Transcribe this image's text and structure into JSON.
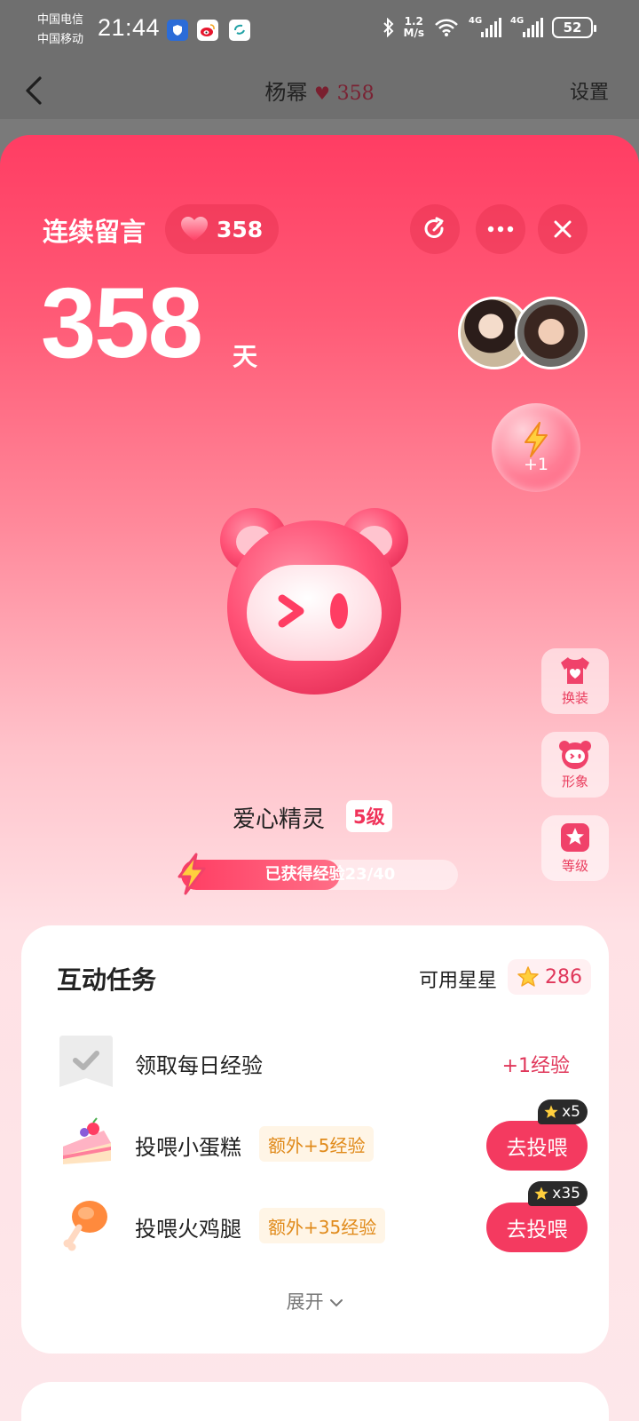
{
  "status_bar": {
    "carrier_1": "中国电信",
    "carrier_2": "中国移动",
    "time": "21:44",
    "net_speed_value": "1.2",
    "net_speed_unit": "M/s",
    "signal_1_tag": "4G",
    "signal_2_tag": "4G",
    "battery": "52"
  },
  "nav": {
    "title": "杨幂",
    "count": "358",
    "settings": "设置"
  },
  "header": {
    "streak_label": "连续留言",
    "heart_count": "358",
    "days": "358",
    "days_unit": "天"
  },
  "energy": {
    "plus_label": "+1"
  },
  "side_buttons": [
    {
      "label": "换装"
    },
    {
      "label": "形象"
    },
    {
      "label": "等级"
    }
  ],
  "pet": {
    "name": "爱心精灵",
    "level": "5级",
    "xp_text": "已获得经验23/40",
    "xp_current": 23,
    "xp_total": 40
  },
  "tasks": {
    "title": "互动任务",
    "stars_label": "可用星星",
    "stars_value": "286",
    "items": [
      {
        "name": "领取每日经验",
        "reward": "+1经验"
      },
      {
        "name": "投喂小蛋糕",
        "bonus": "额外+5经验",
        "button": "去投喂",
        "cost": "x5"
      },
      {
        "name": "投喂火鸡腿",
        "bonus": "额外+35经验",
        "button": "去投喂",
        "cost": "x35"
      }
    ],
    "expand": "展开"
  },
  "colors": {
    "accent": "#f43a60",
    "reward_text": "#e0375a",
    "bonus_text": "#e08a1a"
  }
}
